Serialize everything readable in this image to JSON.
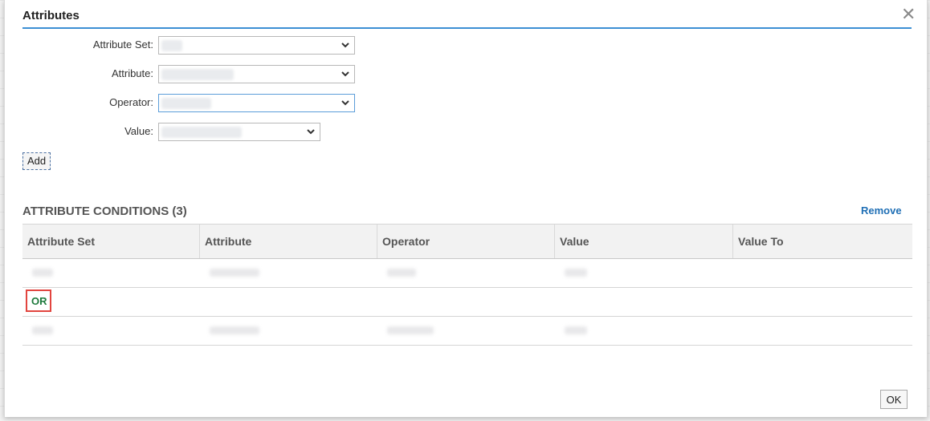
{
  "dialog": {
    "title": "Attributes"
  },
  "form": {
    "attribute_set_label": "Attribute Set:",
    "attribute_label": "Attribute:",
    "operator_label": "Operator:",
    "value_label": "Value:",
    "add_label": "Add"
  },
  "conditions": {
    "title": "ATTRIBUTE CONDITIONS (3)",
    "remove_label": "Remove",
    "columns": [
      "Attribute Set",
      "Attribute",
      "Operator",
      "Value",
      "Value To"
    ],
    "or_label": "OR"
  },
  "footer": {
    "ok_label": "OK"
  },
  "icons": {
    "close": "close-icon",
    "dropdown": "chevron-down-icon"
  },
  "colors": {
    "accent": "#3c8fd4",
    "link": "#1f6fb5",
    "or_text": "#1e7a3c",
    "highlight_border": "#e2453f"
  }
}
